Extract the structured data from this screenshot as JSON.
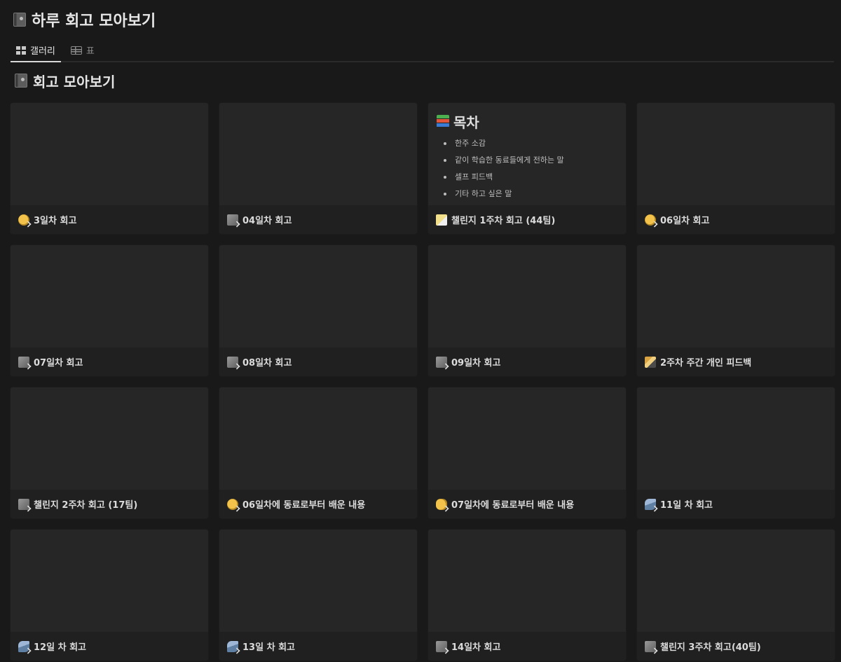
{
  "header": {
    "title": "하루 회고 모아보기",
    "title_icon": "closed-book-icon"
  },
  "tabs": [
    {
      "label": "갤러리",
      "icon": "gallery-icon",
      "active": true
    },
    {
      "label": "표",
      "icon": "table-icon",
      "active": false
    }
  ],
  "section": {
    "title": "회고 모아보기",
    "icon": "closed-book-icon"
  },
  "toc": {
    "title": "목차",
    "icon": "books-icon",
    "items": [
      "한주 소감",
      "같이 학습한 동료들에게 전하는 말",
      "셀프 피드백",
      "기타 하고 싶은 말"
    ]
  },
  "cards": [
    {
      "title": "3일차 회고",
      "icon": "face-icon"
    },
    {
      "title": "04일차 회고",
      "icon": "page-icon"
    },
    {
      "title": "챌린지 1주차 회고 (44팀)",
      "icon": "memo-icon"
    },
    {
      "title": "06일차 회고",
      "icon": "face-icon"
    },
    {
      "title": "07일차 회고",
      "icon": "page-icon"
    },
    {
      "title": "08일차 회고",
      "icon": "page-icon"
    },
    {
      "title": "09일차 회고",
      "icon": "page-icon"
    },
    {
      "title": "2주차 주간 개인 피드백",
      "icon": "ruler-icon"
    },
    {
      "title": "챌린지 2주차 회고 (17팀)",
      "icon": "page-icon"
    },
    {
      "title": "06일차에 동료로부터 배운 내용",
      "icon": "face-icon"
    },
    {
      "title": "07일차에 동료로부터 배운 내용",
      "icon": "thumbs-up-icon"
    },
    {
      "title": "11일 차 회고",
      "icon": "wave-icon"
    },
    {
      "title": "12일 차 회고",
      "icon": "wave-icon"
    },
    {
      "title": "13일 차 회고",
      "icon": "wave-icon"
    },
    {
      "title": "14일차 회고",
      "icon": "page-icon"
    },
    {
      "title": "챌린지 3주차 회고(40팀)",
      "icon": "page-icon"
    }
  ]
}
